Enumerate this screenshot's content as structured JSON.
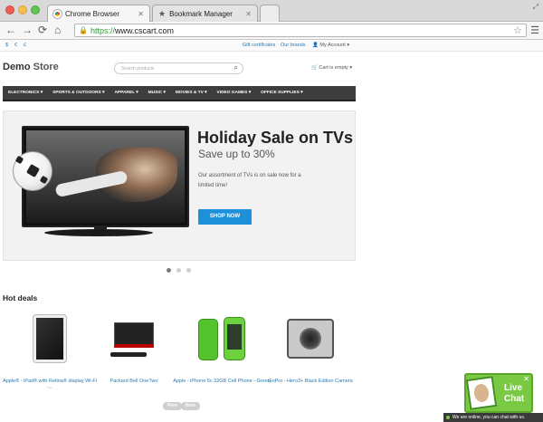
{
  "browser": {
    "tabs": [
      {
        "title": "Chrome Browser",
        "active": true
      },
      {
        "title": "Bookmark Manager",
        "active": false
      }
    ],
    "url": {
      "scheme": "https://",
      "host": "www.cscart.com"
    },
    "nav": {
      "back": "←",
      "forward": "→",
      "reload": "⟳",
      "home": "⌂"
    }
  },
  "topbar": {
    "currencies": [
      "$",
      "€",
      "£"
    ],
    "links": [
      "Gift certificates",
      "Our brands"
    ],
    "account": "My Account ▾"
  },
  "header": {
    "logo_main": "Demo",
    "logo_store": "Store",
    "search_placeholder": "Search products",
    "cart": "Cart is empty ▾"
  },
  "categories": [
    "ELECTRONICS ▾",
    "SPORTS & OUTDOORS ▾",
    "APPAREL ▾",
    "MUSIC ▾",
    "MOVIES & TV ▾",
    "VIDEO GAMES ▾",
    "OFFICE SUPPLIES ▾"
  ],
  "banner": {
    "headline": "Holiday Sale on TVs",
    "subhead": "Save up to 30%",
    "description": "Our assortment of TVs is on sale now for a limited time!",
    "cta": "SHOP NOW",
    "slides_total": 3,
    "slide_active": 1
  },
  "hot_deals": {
    "title": "Hot deals",
    "products": [
      {
        "name": "Apple® - iPad® with Retina® display Wi-Fi -..."
      },
      {
        "name": "Packard Bell OneTwo"
      },
      {
        "name": "Apple - iPhone 5c 32GB Cell Phone - Green"
      },
      {
        "name": "GoPro - Hero3+ Black Edition Camera"
      }
    ],
    "pager": {
      "prev": "Prev",
      "next": "Next"
    }
  },
  "livechat": {
    "line1": "Live",
    "line2": "Chat",
    "status": "We are online, you can chat with us."
  },
  "colors": {
    "accent": "#1e8fd9",
    "link": "#2a7ab0",
    "catbar": "#3d3d3d",
    "chat": "#7ac943"
  }
}
